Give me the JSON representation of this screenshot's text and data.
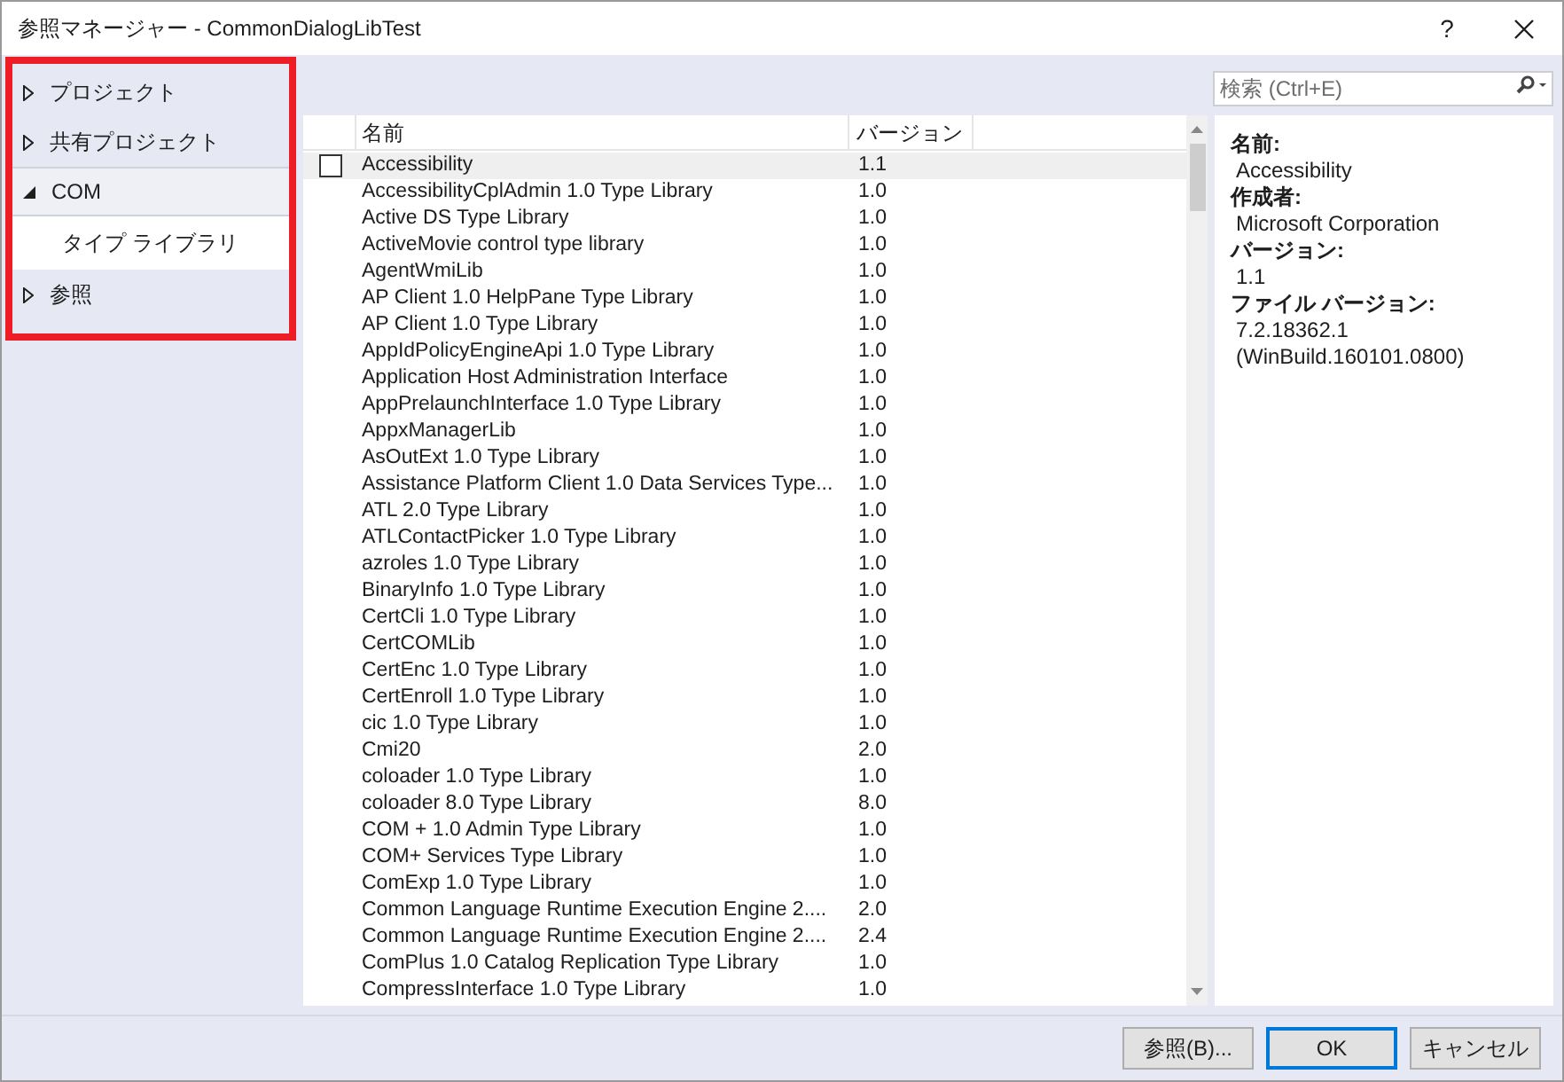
{
  "window": {
    "title": "参照マネージャー - CommonDialogLibTest",
    "help": "?"
  },
  "sidebar": {
    "highlight": true,
    "items": [
      {
        "label": "プロジェクト",
        "expanded": false,
        "selected": false
      },
      {
        "label": "共有プロジェクト",
        "expanded": false,
        "selected": false
      },
      {
        "label": "COM",
        "expanded": true,
        "selected": false,
        "children": [
          {
            "label": "タイプ ライブラリ",
            "selected": true
          }
        ]
      },
      {
        "label": "参照",
        "expanded": false,
        "selected": false
      }
    ]
  },
  "search": {
    "placeholder": "検索 (Ctrl+E)"
  },
  "table": {
    "columns": [
      "名前",
      "バージョン"
    ],
    "rows": [
      {
        "name": "Accessibility",
        "version": "1.1",
        "selected": true,
        "checked": false
      },
      {
        "name": "AccessibilityCplAdmin 1.0 Type Library",
        "version": "1.0",
        "selected": false,
        "checked": false
      },
      {
        "name": "Active DS Type Library",
        "version": "1.0",
        "selected": false,
        "checked": false
      },
      {
        "name": "ActiveMovie control type library",
        "version": "1.0",
        "selected": false,
        "checked": false
      },
      {
        "name": "AgentWmiLib",
        "version": "1.0",
        "selected": false,
        "checked": false
      },
      {
        "name": "AP Client 1.0 HelpPane Type Library",
        "version": "1.0",
        "selected": false,
        "checked": false
      },
      {
        "name": "AP Client 1.0 Type Library",
        "version": "1.0",
        "selected": false,
        "checked": false
      },
      {
        "name": "AppIdPolicyEngineApi 1.0 Type Library",
        "version": "1.0",
        "selected": false,
        "checked": false
      },
      {
        "name": "Application Host Administration Interface",
        "version": "1.0",
        "selected": false,
        "checked": false
      },
      {
        "name": "AppPrelaunchInterface 1.0 Type Library",
        "version": "1.0",
        "selected": false,
        "checked": false
      },
      {
        "name": "AppxManagerLib",
        "version": "1.0",
        "selected": false,
        "checked": false
      },
      {
        "name": "AsOutExt 1.0 Type Library",
        "version": "1.0",
        "selected": false,
        "checked": false
      },
      {
        "name": "Assistance Platform Client 1.0 Data Services Type...",
        "version": "1.0",
        "selected": false,
        "checked": false
      },
      {
        "name": "ATL 2.0 Type Library",
        "version": "1.0",
        "selected": false,
        "checked": false
      },
      {
        "name": "ATLContactPicker 1.0 Type Library",
        "version": "1.0",
        "selected": false,
        "checked": false
      },
      {
        "name": "azroles 1.0 Type Library",
        "version": "1.0",
        "selected": false,
        "checked": false
      },
      {
        "name": "BinaryInfo 1.0 Type Library",
        "version": "1.0",
        "selected": false,
        "checked": false
      },
      {
        "name": "CertCli 1.0 Type Library",
        "version": "1.0",
        "selected": false,
        "checked": false
      },
      {
        "name": "CertCOMLib",
        "version": "1.0",
        "selected": false,
        "checked": false
      },
      {
        "name": "CertEnc 1.0 Type Library",
        "version": "1.0",
        "selected": false,
        "checked": false
      },
      {
        "name": "CertEnroll 1.0 Type Library",
        "version": "1.0",
        "selected": false,
        "checked": false
      },
      {
        "name": "cic 1.0 Type Library",
        "version": "1.0",
        "selected": false,
        "checked": false
      },
      {
        "name": "Cmi20",
        "version": "2.0",
        "selected": false,
        "checked": false
      },
      {
        "name": "coloader 1.0 Type Library",
        "version": "1.0",
        "selected": false,
        "checked": false
      },
      {
        "name": "coloader 8.0 Type Library",
        "version": "8.0",
        "selected": false,
        "checked": false
      },
      {
        "name": "COM + 1.0 Admin Type Library",
        "version": "1.0",
        "selected": false,
        "checked": false
      },
      {
        "name": "COM+ Services Type Library",
        "version": "1.0",
        "selected": false,
        "checked": false
      },
      {
        "name": "ComExp 1.0 Type Library",
        "version": "1.0",
        "selected": false,
        "checked": false
      },
      {
        "name": "Common Language Runtime Execution Engine 2....",
        "version": "2.0",
        "selected": false,
        "checked": false
      },
      {
        "name": "Common Language Runtime Execution Engine 2....",
        "version": "2.4",
        "selected": false,
        "checked": false
      },
      {
        "name": "ComPlus 1.0 Catalog Replication Type Library",
        "version": "1.0",
        "selected": false,
        "checked": false
      },
      {
        "name": "CompressInterface 1.0 Type Library",
        "version": "1.0",
        "selected": false,
        "checked": false
      }
    ]
  },
  "details": [
    {
      "label": "名前:",
      "value": [
        "Accessibility"
      ]
    },
    {
      "label": "作成者:",
      "value": [
        "Microsoft Corporation"
      ]
    },
    {
      "label": "バージョン:",
      "value": [
        "1.1"
      ]
    },
    {
      "label": "ファイル バージョン:",
      "value": [
        "7.2.18362.1",
        "(WinBuild.160101.0800)"
      ]
    }
  ],
  "buttons": [
    {
      "label": "参照(B)...",
      "default": false
    },
    {
      "label": "OK",
      "default": true
    },
    {
      "label": "キャンセル",
      "default": false
    }
  ]
}
